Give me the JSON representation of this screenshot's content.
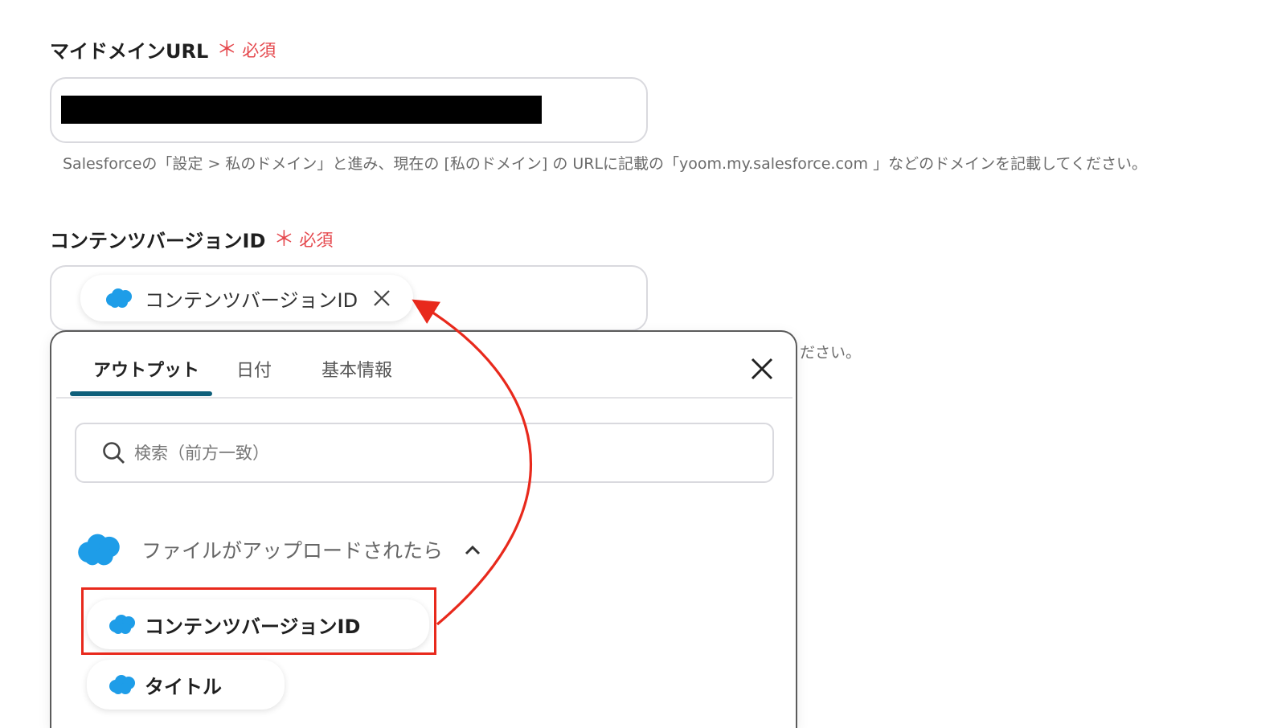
{
  "domain_field": {
    "label": "マイドメインURL",
    "required_mark": "＊",
    "required_text": "必須",
    "hint": "Salesforceの「設定 > 私のドメイン」と進み、現在の [私のドメイン] の URLに記載の「yoom.my.salesforce.com 」などのドメインを記載してください。"
  },
  "content_field": {
    "label": "コンテンツバージョンID",
    "required_mark": "＊",
    "required_text": "必須",
    "selected_chip": "コンテンツバージョンID",
    "hint_tail": "ださい。"
  },
  "picker": {
    "tabs": [
      {
        "label": "アウトプット",
        "active": true
      },
      {
        "label": "日付",
        "active": false
      },
      {
        "label": "基本情報",
        "active": false
      }
    ],
    "search_placeholder": "検索（前方一致）",
    "group": {
      "title": "ファイルがアップロードされたら",
      "items": [
        {
          "label": "コンテンツバージョンID",
          "highlighted": true
        },
        {
          "label": "タイトル",
          "highlighted": false
        }
      ]
    }
  },
  "colors": {
    "required": "#e5484d",
    "salesforce_blue": "#1e9de8",
    "tab_underline": "#0e5f7a",
    "annotation_red": "#e8291c"
  },
  "icons": [
    "salesforce-cloud-icon",
    "close-icon",
    "search-icon",
    "chevron-up-icon"
  ]
}
